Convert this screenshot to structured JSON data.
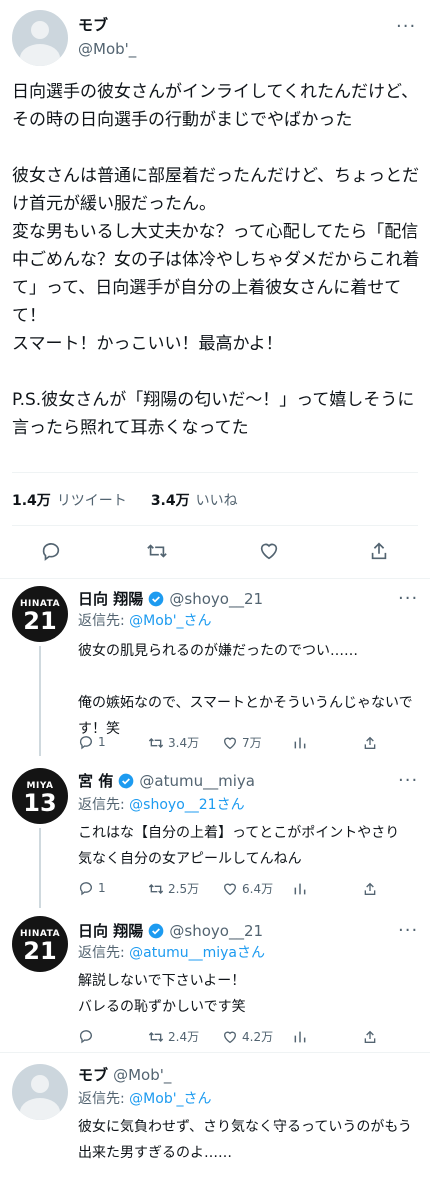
{
  "main_tweet": {
    "name": "モブ",
    "handle": "@Mob'_",
    "text": "日向選手の彼女さんがインライしてくれたんだけど、その時の日向選手の行動がまじでやばかった\n\n彼女さんは普通に部屋着だったんだけど、ちょっとだけ首元が緩い服だったん。\n変な男もいるし大丈夫かな？って心配してたら「配信中ごめんな？女の子は体冷やしちゃダメだからこれ着て」って、日向選手が自分の上着彼女さんに着せてて！\nスマート！かっこいい！最高かよ！\n\nP.S.彼女さんが「翔陽の匂いだ〜！」って嬉しそうに言ったら照れて耳赤くなってた",
    "retweets_count": "1.4万",
    "retweets_label": "リツイート",
    "likes_count": "3.4万",
    "likes_label": "いいね"
  },
  "replies": [
    {
      "name": "日向 翔陽",
      "handle": "@shoyo__21",
      "jersey_name": "HINATA",
      "jersey_number": "21",
      "reply_prefix": "返信先: ",
      "reply_to": "@Mob'_さん",
      "text": "彼女の肌見られるのが嫌だったのでつい……\n\n俺の嫉妬なので、スマートとかそういうんじゃないです！笑",
      "reply_count": "1",
      "retweet_count": "3.4万",
      "like_count": "7万"
    },
    {
      "name": "宮 侑",
      "handle": "@atumu__miya",
      "jersey_name": "MIYA",
      "jersey_number": "13",
      "reply_prefix": "返信先: ",
      "reply_to": "@shoyo__21さん",
      "text": "これはな【自分の上着】ってとこがポイントやさり気なく自分の女アピールしてんねん",
      "reply_count": "1",
      "retweet_count": "2.5万",
      "like_count": "6.4万"
    },
    {
      "name": "日向 翔陽",
      "handle": "@shoyo__21",
      "jersey_name": "HINATA",
      "jersey_number": "21",
      "reply_prefix": "返信先: ",
      "reply_to": "@atumu__miyaさん",
      "text": "解説しないで下さいよー！\nバレるの恥ずかしいです笑",
      "retweet_count": "2.4万",
      "like_count": "4.2万"
    },
    {
      "name": "モブ",
      "handle": "@Mob'_",
      "reply_prefix": "返信先: ",
      "reply_to": "@Mob'_さん",
      "text": "彼女に気負わせず、さり気なく守るっていうのがもう出来た男すぎるのよ……"
    }
  ],
  "colors": {
    "accent": "#1d9bf0",
    "muted": "#536471",
    "verified": "#1d9bf0"
  },
  "icons": [
    "reply-icon",
    "retweet-icon",
    "like-icon",
    "share-icon",
    "more-icon",
    "verified-badge-icon"
  ]
}
